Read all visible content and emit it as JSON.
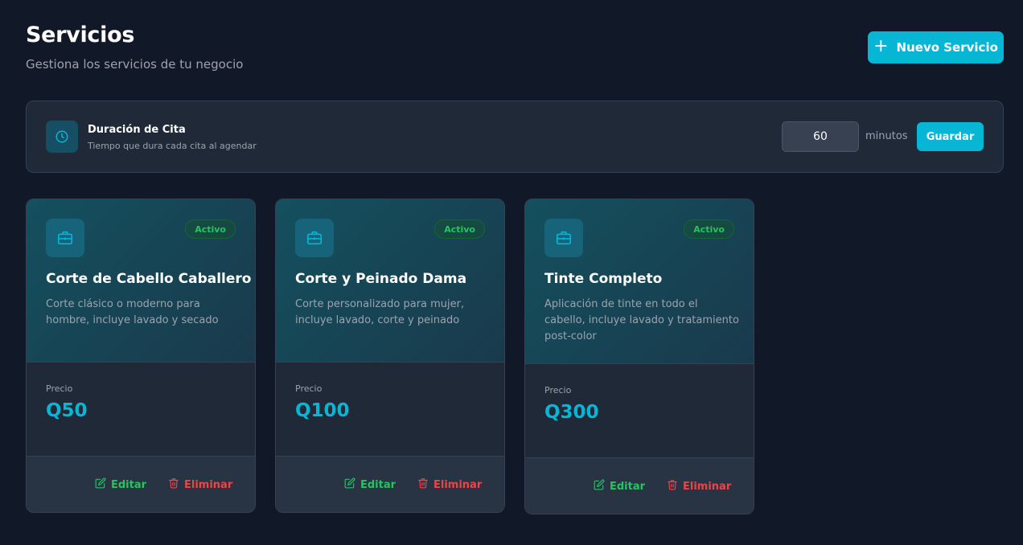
{
  "header": {
    "title": "Servicios",
    "subtitle": "Gestiona los servicios de tu negocio",
    "new_button_label": "Nuevo Servicio"
  },
  "duration": {
    "title": "Duración de Cita",
    "description": "Tiempo que dura cada cita al agendar",
    "value": "60",
    "unit": "minutos",
    "save_label": "Guardar"
  },
  "services": [
    {
      "name": "Corte de Cabello Caballero",
      "description": "Corte clásico o moderno para hombre, incluye lavado y secado",
      "status": "Activo",
      "price_label": "Precio",
      "price": "Q50",
      "edit_label": "Editar",
      "delete_label": "Eliminar"
    },
    {
      "name": "Corte y Peinado Dama",
      "description": "Corte personalizado para mujer, incluye lavado, corte y peinado",
      "status": "Activo",
      "price_label": "Precio",
      "price": "Q100",
      "edit_label": "Editar",
      "delete_label": "Eliminar"
    },
    {
      "name": "Tinte Completo",
      "description": "Aplicación de tinte en todo el cabello, incluye lavado y tratamiento post-color",
      "status": "Activo",
      "price_label": "Precio",
      "price": "Q300",
      "edit_label": "Editar",
      "delete_label": "Eliminar"
    }
  ],
  "icons": {
    "plus": "plus-icon",
    "duration": "clock-icon",
    "service": "briefcase-icon",
    "edit": "edit-icon",
    "delete": "trash-icon"
  },
  "colors": {
    "background": "#111827",
    "accent": "#06b6d4",
    "active": "#22c55e",
    "danger": "#ef4444",
    "panel": "#1f2937"
  }
}
